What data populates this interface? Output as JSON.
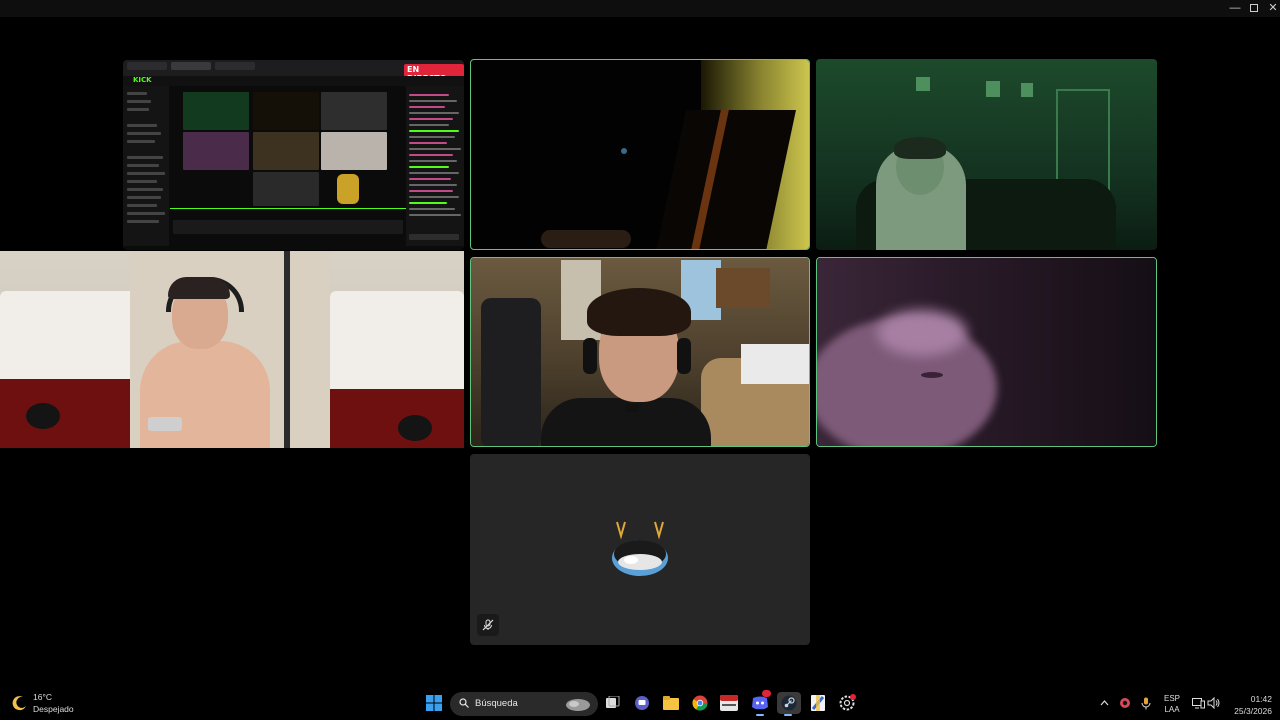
{
  "window": {
    "controls": {
      "minimize": "—",
      "maximize": "",
      "close": "✕"
    }
  },
  "screenshare": {
    "platform": "KICK",
    "live_badge": "EN DIRECTO"
  },
  "tiles": {
    "screenshare": {
      "speaking": false
    },
    "dark_room": {
      "speaking": true
    },
    "green_room": {
      "speaking": false
    },
    "bedroom": {
      "speaking": false
    },
    "headset_boy": {
      "speaking": true
    },
    "purple": {
      "speaking": true
    },
    "avatar": {
      "speaking": false,
      "mic_muted": true
    }
  },
  "taskbar": {
    "weather": {
      "temp": "16°C",
      "desc": "Despejado",
      "icon": "moon-icon"
    },
    "search_placeholder": "Búsqueda",
    "apps": [
      "windows-start-icon",
      "search-icon",
      "task-view-icon",
      "chat-icon",
      "file-explorer-icon",
      "chrome-icon",
      "video-editor-icon",
      "discord-icon",
      "steam-icon",
      "winrar-icon",
      "settings-icon"
    ],
    "tray": {
      "language_top": "ESP",
      "language_bottom": "LAA",
      "time": "01:42",
      "date": "25/3/2026"
    },
    "accent": "#8ab4f8"
  },
  "colors": {
    "speaking_border": "#5fc47e",
    "kick_green": "#53fc18",
    "live_red": "#e0243a"
  }
}
